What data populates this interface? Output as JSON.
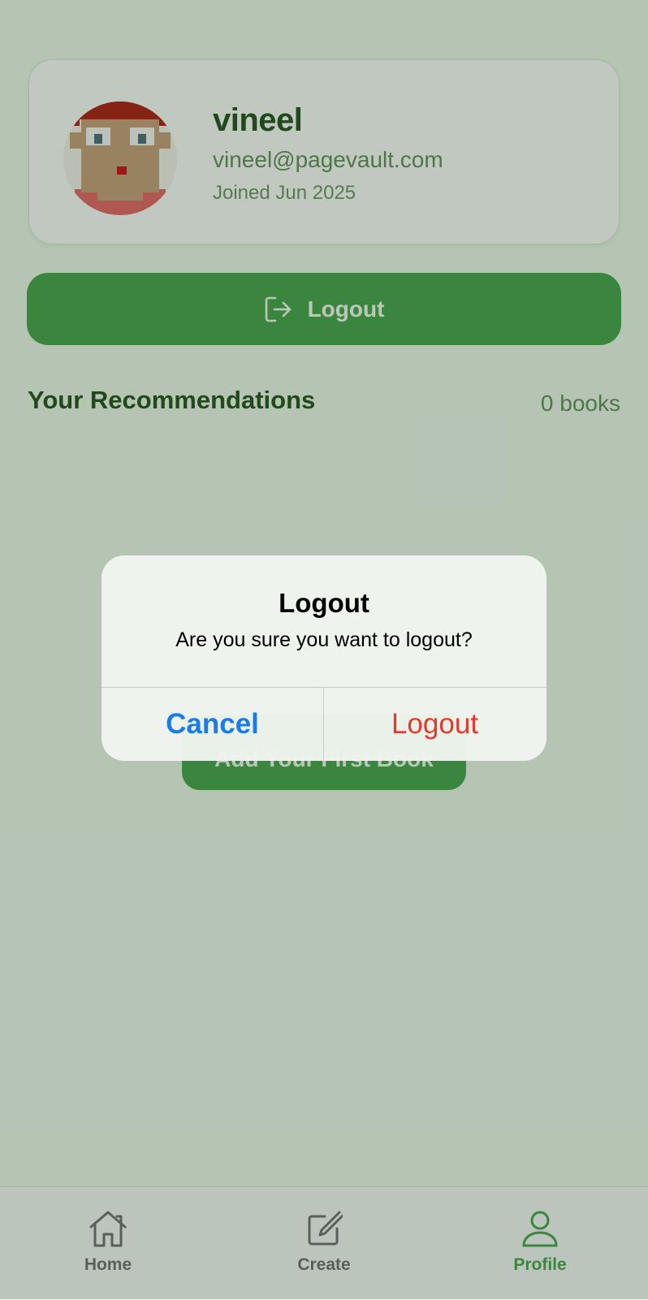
{
  "profile": {
    "name": "vineel",
    "email": "vineel@pagevault.com",
    "joined": "Joined Jun 2025",
    "logout_label": "Logout",
    "logout_icon": "logout-icon"
  },
  "recommendations": {
    "title": "Your Recommendations",
    "count": "0 books",
    "add_first_label": "Add Your First Book"
  },
  "tabs": [
    {
      "label": "Home",
      "icon": "home-icon",
      "active": false
    },
    {
      "label": "Create",
      "icon": "edit-icon",
      "active": false
    },
    {
      "label": "Profile",
      "icon": "user-icon",
      "active": true
    }
  ],
  "dialog": {
    "title": "Logout",
    "message": "Are you sure you want to logout?",
    "cancel_label": "Cancel",
    "confirm_label": "Logout"
  },
  "colors": {
    "primary": "#43a047",
    "cancel": "#1a7bea",
    "destructive": "#e5392f",
    "heading": "#1f4d1a"
  }
}
